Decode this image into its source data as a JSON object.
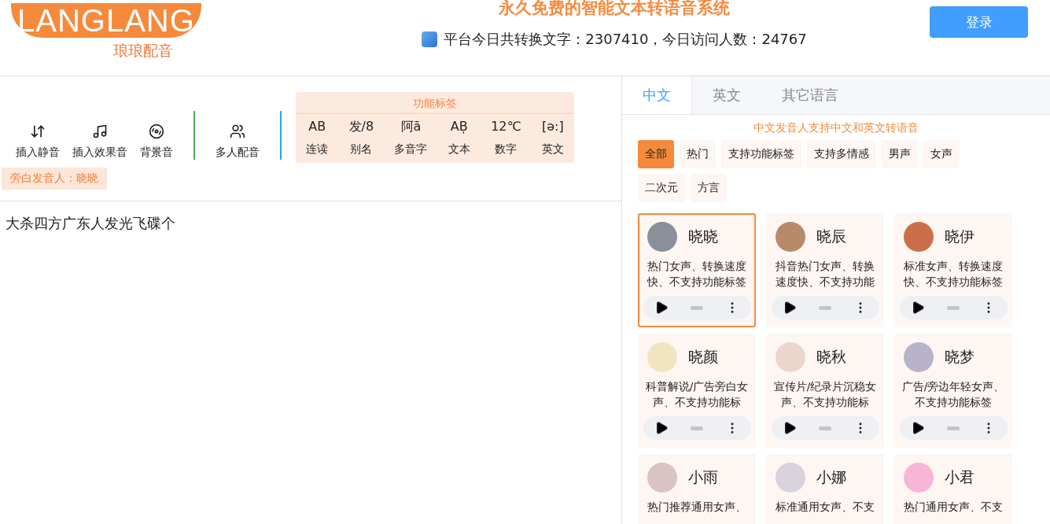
{
  "header": {
    "logo": {
      "wordmark": "LANGLANG",
      "subtitle": "琅琅配音"
    },
    "title": "永久免费的智能文本转语音系统",
    "stats": "平台今日共转换文字：2307410，今日访问人数：24767",
    "login": "登录"
  },
  "toolbar": {
    "tools": [
      {
        "kind": "silence",
        "label": "插入静音"
      },
      {
        "kind": "effect",
        "label": "插入效果音"
      },
      {
        "kind": "bgm",
        "label": "背景音"
      }
    ],
    "multi": {
      "kind": "multi",
      "label": "多人配音"
    },
    "tags_title": "功能标签",
    "tags": [
      {
        "glyph": "AB",
        "label": "连读"
      },
      {
        "glyph": "发/8",
        "label": "别名"
      },
      {
        "glyph": "阿ā",
        "label": "多音字"
      },
      {
        "glyph": "AB̩",
        "label": "文本"
      },
      {
        "glyph": "12℃",
        "label": "数字"
      },
      {
        "glyph": "[ə:]",
        "label": "英文"
      }
    ]
  },
  "narrator": "旁白发音人：晓晓",
  "editor": {
    "value": "大杀四方广东人发光飞碟个"
  },
  "voice_panel": {
    "tabs": [
      {
        "label": "中文",
        "selected": true
      },
      {
        "label": "英文",
        "selected": false
      },
      {
        "label": "其它语言",
        "selected": false
      }
    ],
    "hint": "中文发音人支持中文和英文转语音",
    "filters": [
      {
        "label": "全部",
        "selected": true
      },
      {
        "label": "热门",
        "selected": false
      },
      {
        "label": "支持功能标签",
        "selected": false
      },
      {
        "label": "支持多情感",
        "selected": false
      },
      {
        "label": "男声",
        "selected": false
      },
      {
        "label": "女声",
        "selected": false
      },
      {
        "label": "二次元",
        "selected": false
      },
      {
        "label": "方言",
        "selected": false
      }
    ],
    "voices": [
      {
        "name": "晓晓",
        "desc": "热门女声、转换速度快、不支持功能标签",
        "selected": true,
        "color": "#8a8f99"
      },
      {
        "name": "晓辰",
        "desc": "抖音热门女声、转换速度快、不支持功能",
        "selected": false,
        "color": "#b88a6a"
      },
      {
        "name": "晓伊",
        "desc": "标准女声、转换速度快、不支持功能标签",
        "selected": false,
        "color": "#c9704a"
      },
      {
        "name": "晓颜",
        "desc": "科普解说/广告旁白女声、不支持功能标",
        "selected": false,
        "color": "#f3e4c0"
      },
      {
        "name": "晓秋",
        "desc": "宣传片/纪录片沉稳女声、不支持功能标",
        "selected": false,
        "color": "#ecd6cb"
      },
      {
        "name": "晓梦",
        "desc": "广告/旁边年轻女声、不支持功能标签",
        "selected": false,
        "color": "#b9b2cc"
      },
      {
        "name": "小雨",
        "desc": "热门推荐通用女声、",
        "selected": false,
        "color": "#d9c3c3"
      },
      {
        "name": "小娜",
        "desc": "标准通用女声、不支",
        "selected": false,
        "color": "#d8d2dc"
      },
      {
        "name": "小君",
        "desc": "热门通用女声、不支",
        "selected": false,
        "color": "#f7b6d6"
      }
    ]
  }
}
